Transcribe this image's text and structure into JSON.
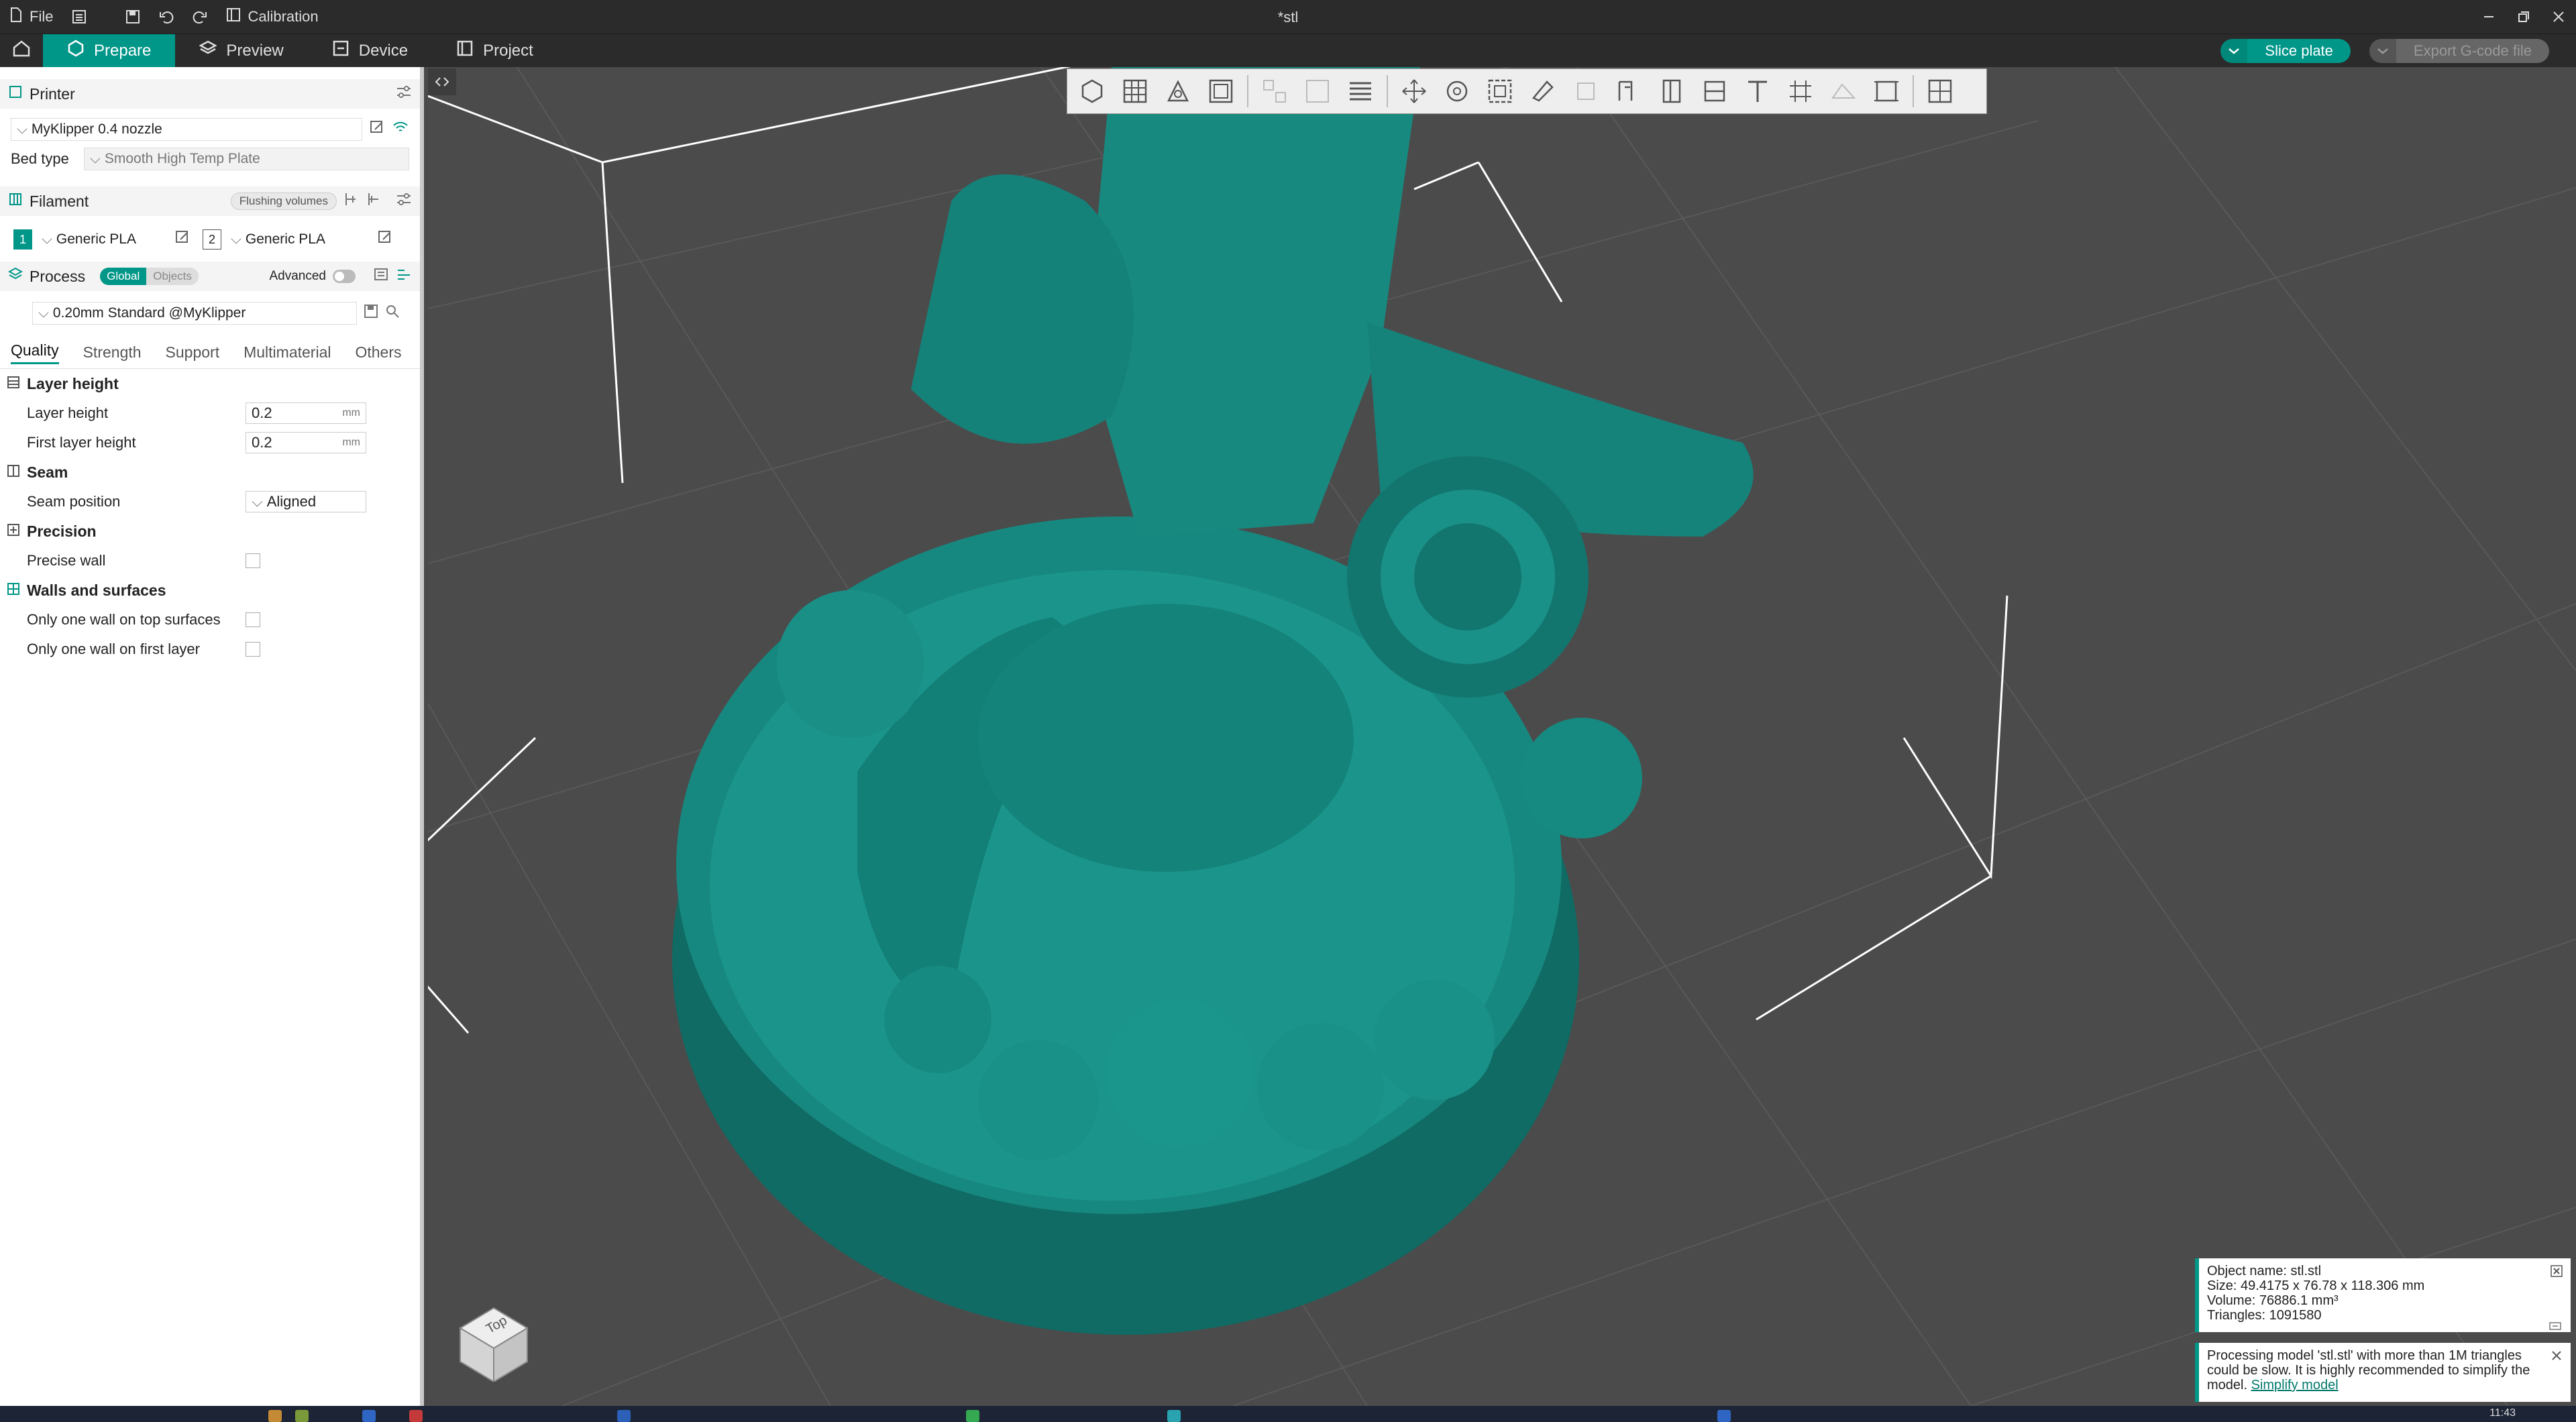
{
  "titlebar": {
    "file_label": "File",
    "calibration_label": "Calibration",
    "window_title": "*stl"
  },
  "tabs": {
    "prepare": "Prepare",
    "preview": "Preview",
    "device": "Device",
    "project": "Project"
  },
  "actions": {
    "slice": "Slice plate",
    "export": "Export G-code file"
  },
  "printer": {
    "section_title": "Printer",
    "name": "MyKlipper 0.4 nozzle",
    "bed_type_label": "Bed type",
    "bed_type": "Smooth High Temp Plate"
  },
  "filament": {
    "section_title": "Filament",
    "flushing_label": "Flushing volumes",
    "slots": [
      {
        "num": "1",
        "name": "Generic PLA",
        "color": "#009688"
      },
      {
        "num": "2",
        "name": "Generic PLA",
        "color": "#ffffff"
      }
    ]
  },
  "process": {
    "section_title": "Process",
    "global_label": "Global",
    "objects_label": "Objects",
    "advanced_label": "Advanced",
    "preset": "0.20mm Standard @MyKlipper",
    "tabs": [
      "Quality",
      "Strength",
      "Support",
      "Multimaterial",
      "Others"
    ]
  },
  "quality": {
    "layer_height_group": "Layer height",
    "layer_height_label": "Layer height",
    "layer_height_value": "0.2",
    "first_layer_height_label": "First layer height",
    "first_layer_height_value": "0.2",
    "unit_mm": "mm",
    "seam_group": "Seam",
    "seam_position_label": "Seam position",
    "seam_position_value": "Aligned",
    "precision_group": "Precision",
    "precise_wall_label": "Precise wall",
    "walls_group": "Walls and surfaces",
    "one_wall_top_label": "Only one wall on top surfaces",
    "one_wall_first_label": "Only one wall on first layer"
  },
  "nav_cube": {
    "top_label": "Top"
  },
  "notifications": {
    "object_name": "Object name: stl.stl",
    "size": "Size: 49.4175 x 76.78 x 118.306 mm",
    "volume": "Volume: 76886.1 mm³",
    "triangles": "Triangles: 1091580",
    "processing_text": "Processing model 'stl.stl' with more than 1M triangles could be slow. It is highly recommended to simplify the model.",
    "simplify_link": "Simplify model"
  },
  "taskbar": {
    "clock": "11:43"
  },
  "colors": {
    "accent": "#009688",
    "model": "#17887f",
    "viewport_bg": "#4b4b4b",
    "titlebar_bg": "#2b2b2b"
  }
}
